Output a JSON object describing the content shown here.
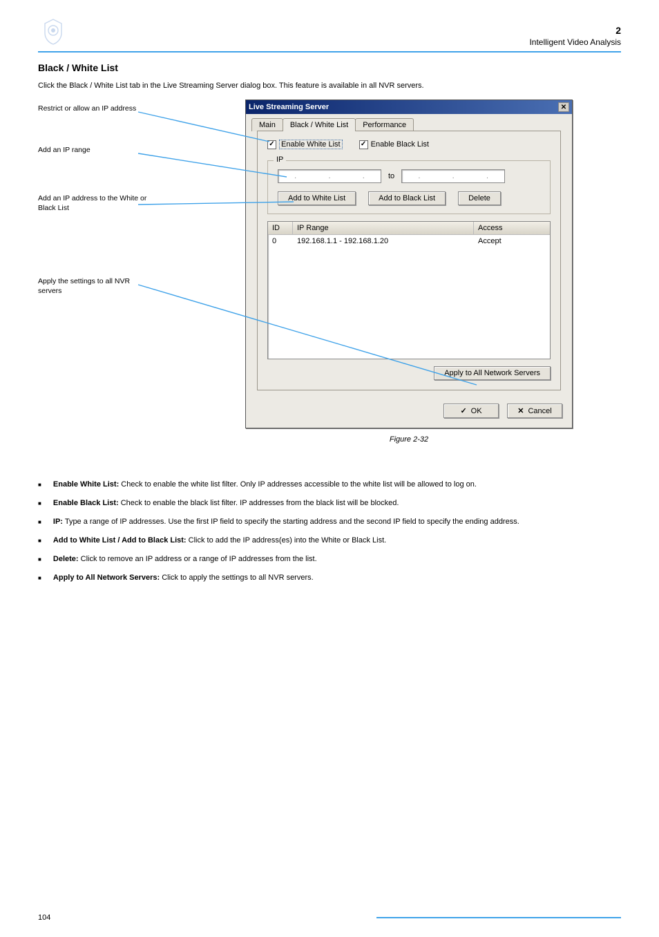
{
  "header": {
    "chapter_num": "2",
    "chapter_title": "Intelligent Video Analysis"
  },
  "intro": {
    "title": "Black / White List",
    "paragraph": "Click the Black / White List tab in the Live Streaming Server dialog box. This feature is available in all NVR servers."
  },
  "callouts": {
    "c1": "Restrict or allow an IP address",
    "c2": "Add an IP range",
    "c3": "Add an IP address to the White or Black List",
    "c4": "Apply the settings to all NVR servers"
  },
  "dialog": {
    "title": "Live Streaming Server",
    "tabs": {
      "main": "Main",
      "bw": "Black / White List",
      "perf": "Performance"
    },
    "enable_white": "Enable White List",
    "enable_black": "Enable Black List",
    "ip_label": "IP",
    "to_label": "to",
    "btn_add_white": "Add to White List",
    "btn_add_black": "Add to Black List",
    "btn_delete": "Delete",
    "columns": {
      "id": "ID",
      "range": "IP Range",
      "access": "Access"
    },
    "rows": [
      {
        "id": "0",
        "range": "192.168.1.1 - 192.168.1.20",
        "access": "Accept"
      }
    ],
    "apply_all": "Apply to All Network Servers",
    "ok": "OK",
    "cancel": "Cancel"
  },
  "figure_caption": "Figure 2-32",
  "descriptions": {
    "d1_lead": "Enable White List:",
    "d1_body": " Check to enable the white list filter. Only IP addresses accessible to the white list will be allowed to log on.",
    "d2_lead": "Enable Black List:",
    "d2_body": " Check to enable the black list filter. IP addresses from the black list will be blocked.",
    "d3_lead": "IP:",
    "d3_body": " Type a range of IP addresses. Use the first IP field to specify the starting address and the second IP field to specify the ending address.",
    "d4_lead": "Add to White List / Add to Black List:",
    "d4_body": " Click to add the IP address(es) into the White or Black List.",
    "d5_lead": "Delete:",
    "d5_body": " Click to remove an IP address or a range of IP addresses from the list.",
    "d6_lead": "Apply to All Network Servers:",
    "d6_body": " Click to apply the settings to all NVR servers."
  },
  "footer": {
    "page": "104"
  }
}
